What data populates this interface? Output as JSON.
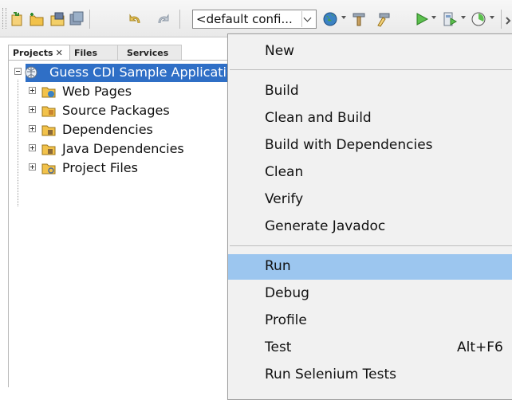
{
  "toolbar": {
    "config_combo": "<default confi...",
    "icons": [
      "new-project-icon",
      "new-file-icon",
      "open-project-icon",
      "save-all-icon",
      "undo-icon",
      "redo-icon",
      "browser-icon",
      "build-icon",
      "clean-build-icon",
      "run-icon",
      "debug-icon",
      "profile-icon"
    ]
  },
  "panel": {
    "tabs": [
      {
        "label": "Projects",
        "close": "✕"
      },
      {
        "label": "Files"
      },
      {
        "label": "Services"
      }
    ],
    "tree": {
      "root": "Guess CDI Sample Application",
      "children": [
        "Web Pages",
        "Source Packages",
        "Dependencies",
        "Java Dependencies",
        "Project Files"
      ]
    }
  },
  "menu": {
    "items": [
      {
        "label": "New",
        "submenu": true
      },
      {
        "label": "Build"
      },
      {
        "label": "Clean and Build"
      },
      {
        "label": "Build with Dependencies"
      },
      {
        "label": "Clean"
      },
      {
        "label": "Verify"
      },
      {
        "label": "Generate Javadoc"
      },
      {
        "label": "Run",
        "highlighted": true
      },
      {
        "label": "Debug"
      },
      {
        "label": "Profile"
      },
      {
        "label": "Test",
        "shortcut": "Alt+F6"
      },
      {
        "label": "Run Selenium Tests"
      }
    ]
  },
  "colors": {
    "selection": "#2f6fc6",
    "menu_highlight": "#9cc6ef",
    "menu_bg": "#f1f1f1"
  }
}
